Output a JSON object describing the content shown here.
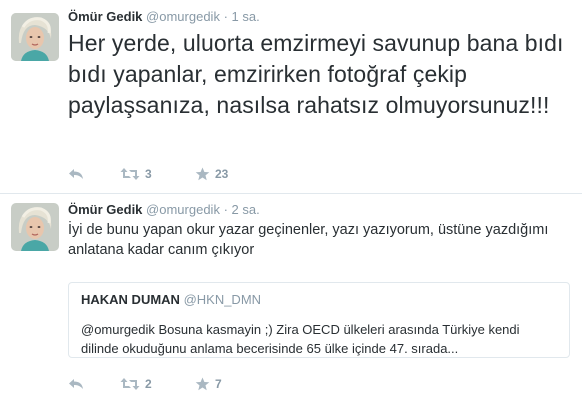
{
  "colors": {
    "text": "#292f33",
    "muted": "#8899a6",
    "border": "#e1e8ed",
    "icon": "#aab8c2"
  },
  "tweets": [
    {
      "fullname": "Ömür Gedik",
      "username": "@omurgedik",
      "separator": "·",
      "time": "1 sa.",
      "text": "Her yerde, uluorta emzirmeyi savunup bana bıdı bıdı yapanlar, emzirirken fotoğraf çekip paylaşsanıza, nasılsa rahatsız olmuyorsunuz!!!",
      "icons": {
        "reply": "reply-icon",
        "retweet": "retweet-icon",
        "favorite": "star-icon"
      },
      "retweets": "3",
      "favorites": "23"
    },
    {
      "fullname": "Ömür Gedik",
      "username": "@omurgedik",
      "separator": "·",
      "time": "2 sa.",
      "text": "İyi de bunu yapan okur yazar geçinenler, yazı yazıyorum, üstüne yazdığımı anlatana kadar canım çıkıyor",
      "quote": {
        "name": "HAKAN DUMAN",
        "username": "@HKN_DMN",
        "text": "@omurgedik Bosuna kasmayin ;) Zira OECD ülkeleri arasında Türkiye kendi dilinde okuduğunu anlama becerisinde 65 ülke içinde 47. sırada..."
      },
      "icons": {
        "reply": "reply-icon",
        "retweet": "retweet-icon",
        "favorite": "star-icon"
      },
      "retweets": "2",
      "favorites": "7"
    }
  ]
}
